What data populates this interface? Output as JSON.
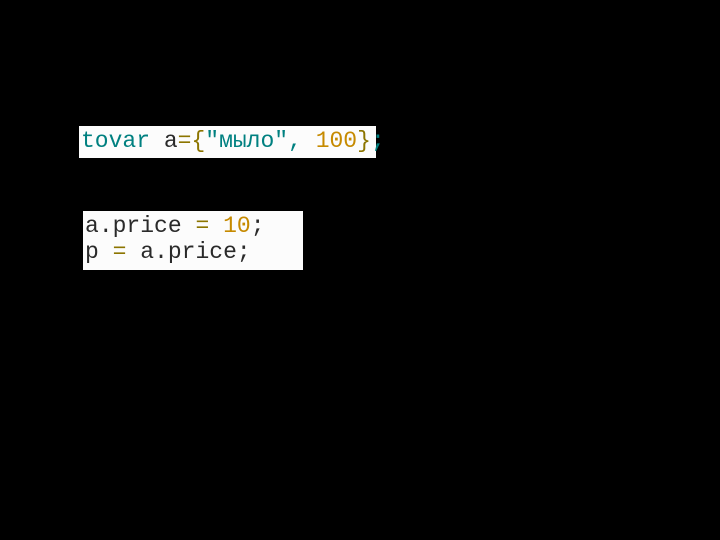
{
  "block1": {
    "type_kw": "tovar",
    "sp1": " ",
    "ident": "a",
    "eq": "=",
    "lbrace": "{",
    "str": "\"мыло\"",
    "comma": ", ",
    "num": "100",
    "rbrace": "}",
    "semi": ";"
  },
  "block2": {
    "line1": {
      "ident": "a",
      "dot": ".",
      "member": "price",
      "sp1": " ",
      "eq": "=",
      "sp2": " ",
      "num": "10",
      "semi": ";"
    },
    "line2": {
      "ident": "p",
      "sp1": " ",
      "eq": "=",
      "sp2": " ",
      "rhs_ident": "a",
      "dot": ".",
      "member": "price",
      "semi": ";"
    }
  }
}
